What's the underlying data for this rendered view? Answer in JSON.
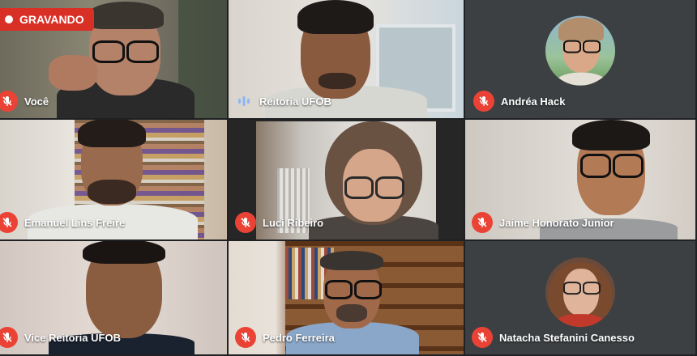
{
  "recording": {
    "label": "GRAVANDO"
  },
  "participants": [
    {
      "name": "Você",
      "mic": "muted"
    },
    {
      "name": "Reitoria UFOB",
      "mic": "speaking"
    },
    {
      "name": "Andréa Hack",
      "mic": "muted"
    },
    {
      "name": "Emanuel Lins Freire",
      "mic": "muted"
    },
    {
      "name": "Luci Ribeiro",
      "mic": "muted"
    },
    {
      "name": "Jaime Honorato Junior",
      "mic": "muted"
    },
    {
      "name": "Vice Reitoria UFOB",
      "mic": "muted"
    },
    {
      "name": "Pedro Ferreira",
      "mic": "muted"
    },
    {
      "name": "Natacha Stefanini Canesso",
      "mic": "muted"
    }
  ],
  "colors": {
    "muted": "#ea4335",
    "recording": "#d93025",
    "speaking": "#8ab4f8",
    "background": "#202124"
  }
}
